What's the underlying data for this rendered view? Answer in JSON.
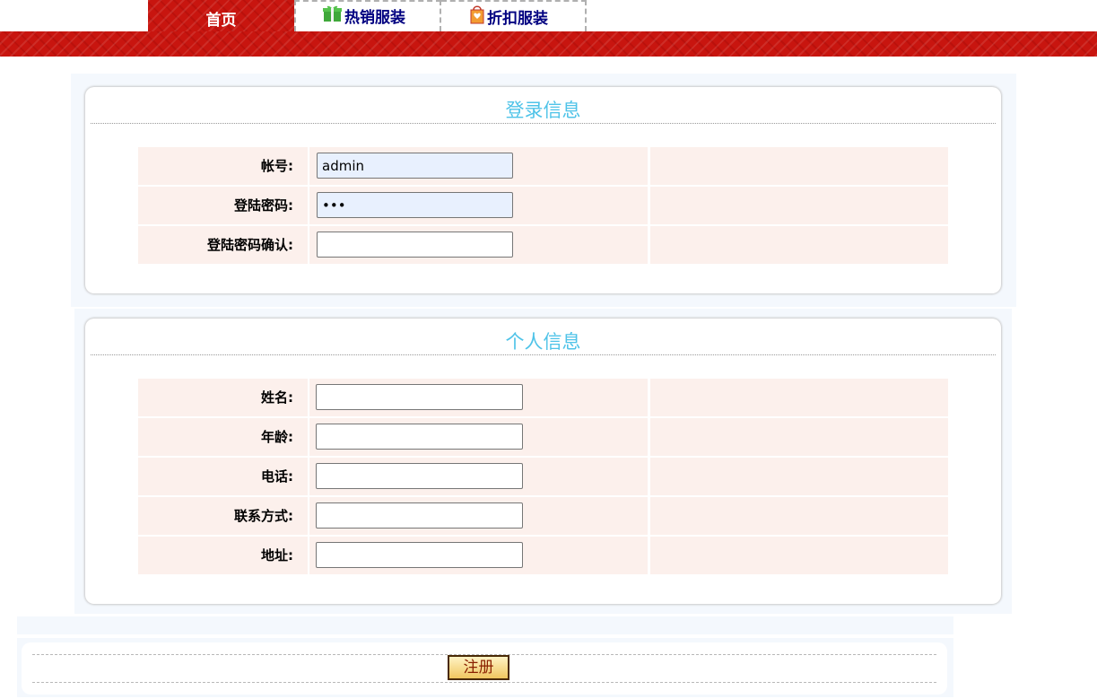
{
  "nav": {
    "tabs": [
      {
        "label": "首页",
        "icon": "none",
        "active": true
      },
      {
        "label": "热销服装",
        "icon": "gift-icon",
        "active": false
      },
      {
        "label": "折扣服装",
        "icon": "shopping-bag-icon",
        "active": false
      }
    ],
    "band_color": "#c8150f"
  },
  "login_section": {
    "title": "登录信息",
    "fields": [
      {
        "label": "帐号:",
        "value": "admin",
        "type": "text"
      },
      {
        "label": "登陆密码:",
        "value": "123",
        "type": "password"
      },
      {
        "label": "登陆密码确认:",
        "value": "",
        "type": "password"
      }
    ]
  },
  "personal_section": {
    "title": "个人信息",
    "fields": [
      {
        "label": "姓名:",
        "value": ""
      },
      {
        "label": "年龄:",
        "value": ""
      },
      {
        "label": "电话:",
        "value": ""
      },
      {
        "label": "联系方式:",
        "value": ""
      },
      {
        "label": "地址:",
        "value": ""
      }
    ]
  },
  "actions": {
    "register_label": "注册"
  },
  "colors": {
    "title": "#4fc3e8",
    "row_bg": "#fcf0ec",
    "tab_text": "#000080"
  }
}
